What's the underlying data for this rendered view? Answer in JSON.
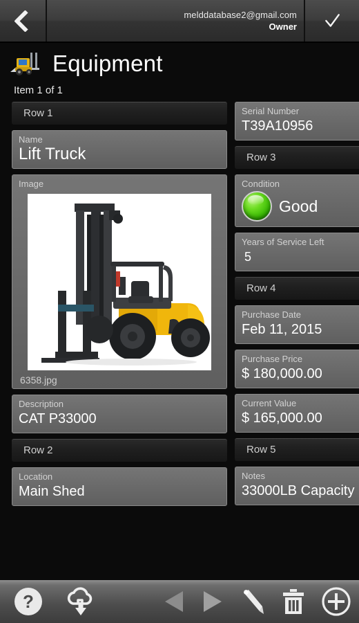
{
  "topbar": {
    "back_icon": "chevron-left-icon",
    "email": "melddatabase2@gmail.com",
    "role": "Owner",
    "confirm_icon": "check-icon"
  },
  "header": {
    "icon": "forklift-icon",
    "title": "Equipment",
    "item_count": "Item 1 of 1"
  },
  "left_column": {
    "row1_label": "Row 1",
    "name": {
      "label": "Name",
      "value": "Lift Truck"
    },
    "image": {
      "label": "Image",
      "caption": "6358.jpg",
      "alt": "forklift-photo"
    },
    "description": {
      "label": "Description",
      "value": "CAT P33000"
    },
    "row2_label": "Row 2",
    "location": {
      "label": "Location",
      "value": "Main Shed"
    }
  },
  "right_column": {
    "serial": {
      "label": "Serial Number",
      "value": "T39A10956"
    },
    "row3_label": "Row 3",
    "condition": {
      "label": "Condition",
      "value": "Good",
      "indicator_color": "#4ecc12"
    },
    "years_left": {
      "label": "Years of Service Left",
      "value": "5"
    },
    "row4_label": "Row 4",
    "purchase_date": {
      "label": "Purchase Date",
      "value": "Feb 11, 2015"
    },
    "purchase_price": {
      "label": "Purchase Price",
      "value": "$ 180,000.00"
    },
    "current_value": {
      "label": "Current Value",
      "value": "$ 165,000.00"
    },
    "row5_label": "Row 5",
    "notes": {
      "label": "Notes",
      "value": "33000LB Capacity"
    }
  },
  "toolbar": {
    "help": "help-icon",
    "download": "cloud-download-icon",
    "previous": "previous-arrow-icon",
    "next": "next-arrow-icon",
    "edit": "pencil-icon",
    "delete": "trash-icon",
    "add": "plus-circle-icon"
  }
}
